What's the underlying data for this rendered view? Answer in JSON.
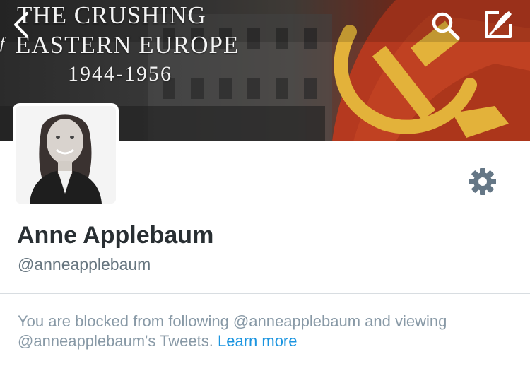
{
  "header": {
    "book_title": {
      "line1": "THE CRUSHING",
      "line2": "EASTERN EUROPE",
      "line3": "1944-1956",
      "fragment": "f"
    },
    "back_icon": "chevron-left-icon",
    "search_icon": "search-icon",
    "compose_icon": "compose-icon"
  },
  "profile": {
    "avatar_icon": "avatar",
    "display_name": "Anne Applebaum",
    "handle": "@anneapplebaum",
    "settings_icon": "gear-icon"
  },
  "blocked": {
    "message": "You are blocked from following @anneapplebaum and viewing @anneapplebaum's Tweets.",
    "link_text": "Learn more"
  },
  "colors": {
    "link": "#1b95e0",
    "name": "#292f33",
    "secondary": "#66757f",
    "message": "#8899a6",
    "divider": "#d8dde1",
    "gear": "#657786"
  }
}
